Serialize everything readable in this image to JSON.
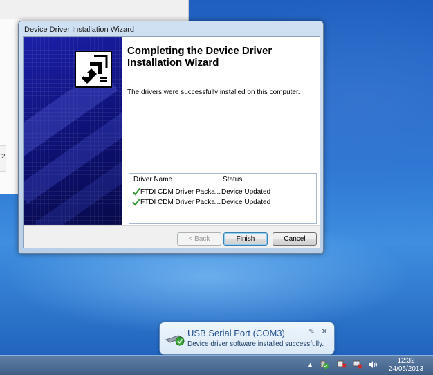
{
  "wizard": {
    "title": "Device Driver Installation Wizard",
    "heading": "Completing the Device Driver Installation Wizard",
    "message": "The drivers were successfully installed on this computer.",
    "list": {
      "columns": [
        "Driver Name",
        "Status"
      ],
      "rows": [
        {
          "name": "FTDI CDM Driver Packa...",
          "status": "Device Updated"
        },
        {
          "name": "FTDI CDM Driver Packa...",
          "status": "Device Updated"
        }
      ]
    },
    "buttons": {
      "back": "< Back",
      "finish": "Finish",
      "cancel": "Cancel"
    }
  },
  "background_window": {
    "visible_text": "2"
  },
  "notification": {
    "title": "USB Serial Port (COM3)",
    "message": "Device driver software installed successfully.",
    "pin_glyph": "✎",
    "close_glyph": "✕"
  },
  "taskbar": {
    "time": "12:32",
    "date": "24/05/2013",
    "tray_arrow": "▲"
  },
  "colors": {
    "banner_dark": "#0c0f6e",
    "check_green": "#2f9a2f",
    "taskbar": "#4a6b94"
  },
  "icons": {
    "banner": "hardware-install-icon",
    "check": "green-check-icon",
    "usb_device": "usb-device-icon",
    "pin": "pin-icon",
    "close": "close-icon"
  }
}
